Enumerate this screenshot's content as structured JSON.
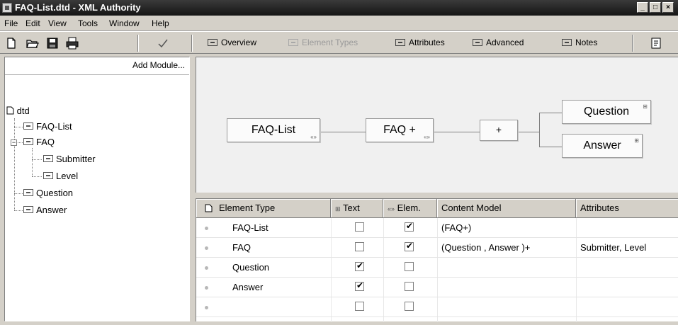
{
  "window": {
    "title": "FAQ-List.dtd - XML Authority"
  },
  "window_buttons": {
    "minimize": "_",
    "maximize": "□",
    "close": "×"
  },
  "menu": [
    "File",
    "Edit",
    "View",
    "Tools",
    "Window",
    "Help"
  ],
  "toolbar": {
    "tabs": [
      {
        "label": "Overview",
        "enabled": true
      },
      {
        "label": "Element Types",
        "enabled": false
      },
      {
        "label": "Attributes",
        "enabled": true
      },
      {
        "label": "Advanced",
        "enabled": true
      },
      {
        "label": "Notes",
        "enabled": true
      }
    ]
  },
  "left_pane": {
    "add_module_label": "Add Module...",
    "root": "dtd",
    "tree": [
      {
        "label": "FAQ-List",
        "level": 1
      },
      {
        "label": "FAQ",
        "level": 1,
        "expanded": true
      },
      {
        "label": "Submitter",
        "level": 2
      },
      {
        "label": "Level",
        "level": 2
      },
      {
        "label": "Question",
        "level": 1
      },
      {
        "label": "Answer",
        "level": 1
      }
    ],
    "expander_symbol": "−"
  },
  "diagram": {
    "nodes": {
      "root": "FAQ-List",
      "faq": "FAQ +",
      "seq": "+",
      "question": "Question",
      "answer": "Answer"
    },
    "sub_marks": {
      "element": "«»",
      "text": "⊞"
    }
  },
  "grid": {
    "columns": [
      "Element Type",
      "Text",
      "Elem.",
      "Content Model",
      "Attributes"
    ],
    "rows": [
      {
        "name": "FAQ-List",
        "text": false,
        "elem": true,
        "model": "(FAQ+)",
        "attributes": ""
      },
      {
        "name": "FAQ",
        "text": false,
        "elem": true,
        "model": "(Question , Answer )+",
        "attributes": "Submitter, Level"
      },
      {
        "name": "Question",
        "text": true,
        "elem": false,
        "model": "",
        "attributes": ""
      },
      {
        "name": "Answer",
        "text": true,
        "elem": false,
        "model": "",
        "attributes": ""
      },
      {
        "name": "",
        "text": false,
        "elem": false,
        "model": "",
        "attributes": ""
      }
    ]
  }
}
